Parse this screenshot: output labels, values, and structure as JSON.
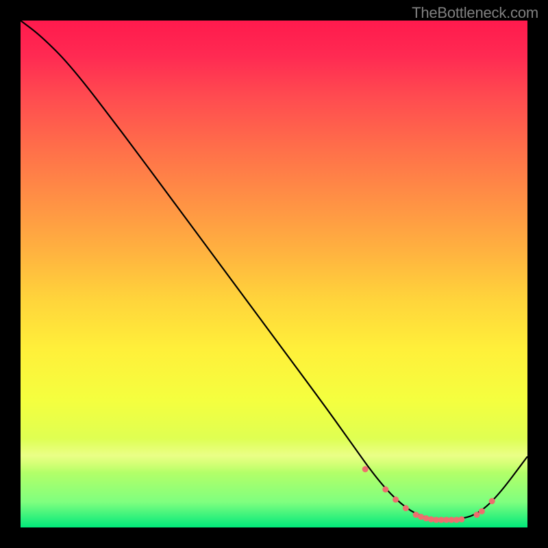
{
  "watermark": "TheBottleneck.com",
  "chart_data": {
    "type": "line",
    "title": "",
    "xlabel": "",
    "ylabel": "",
    "xlim": [
      0,
      100
    ],
    "ylim": [
      0,
      100
    ],
    "series": [
      {
        "name": "bottleneck-curve",
        "x": [
          0,
          4,
          10,
          20,
          30,
          40,
          50,
          60,
          65,
          70,
          74,
          78,
          82,
          86,
          90,
          94,
          100
        ],
        "values": [
          100,
          97,
          91,
          78,
          64.5,
          51,
          37.5,
          24,
          17,
          10,
          5.5,
          2.5,
          1.5,
          1.5,
          2.5,
          6,
          14
        ]
      }
    ],
    "markers": {
      "name": "highlight-dots",
      "x": [
        68,
        72,
        74,
        76,
        78,
        79,
        80,
        81,
        82,
        83,
        84,
        85,
        86,
        87,
        90,
        91,
        93
      ],
      "values": [
        11.5,
        7.5,
        5.5,
        3.8,
        2.5,
        2.1,
        1.8,
        1.6,
        1.5,
        1.5,
        1.5,
        1.5,
        1.5,
        1.6,
        2.5,
        3.2,
        5.2
      ]
    },
    "gradient_stops": [
      {
        "pos": 0,
        "color": "#ff1a4d"
      },
      {
        "pos": 15,
        "color": "#ff4b50"
      },
      {
        "pos": 35,
        "color": "#ff8f45"
      },
      {
        "pos": 55,
        "color": "#ffd43b"
      },
      {
        "pos": 75,
        "color": "#f4ff3f"
      },
      {
        "pos": 95,
        "color": "#7fff7f"
      },
      {
        "pos": 100,
        "color": "#00e87a"
      }
    ]
  }
}
